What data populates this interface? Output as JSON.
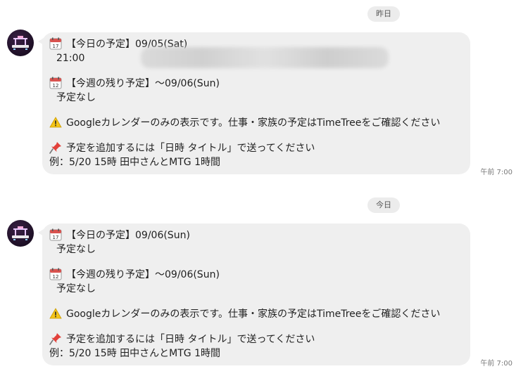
{
  "messages": [
    {
      "date_label": "昨日",
      "lines": {
        "today_header": "【今日の予定】09/05(Sat)",
        "today_item": "21:00",
        "week_header": "【今週の残り予定】〜09/06(Sun)",
        "week_item": "予定なし",
        "warning": "Googleカレンダーのみの表示です。仕事・家族の予定はTimeTreeをご確認ください",
        "add_hint": "予定を追加するには「日時 タイトル」で送ってください",
        "example": "例：5/20 15時 田中さんとMTG 1時間"
      },
      "time": "午前 7:00"
    },
    {
      "date_label": "今日",
      "lines": {
        "today_header": "【今日の予定】09/06(Sun)",
        "today_item": "予定なし",
        "week_header": "【今週の残り予定】〜09/06(Sun)",
        "week_item": "予定なし",
        "warning": "Googleカレンダーのみの表示です。仕事・家族の予定はTimeTreeをご確認ください",
        "add_hint": "予定を追加するには「日時 タイトル」で送ってください",
        "example": "例：5/20 15時 田中さんとMTG 1時間"
      },
      "time": "午前 7:00"
    }
  ],
  "icons": {
    "calendar_today": "calendar-17-icon",
    "calendar_week": "calendar-12-icon",
    "warning": "warning-icon",
    "pin": "pushpin-icon"
  },
  "colors": {
    "bubble": "#efefef",
    "date_chip": "#ececec",
    "calendar_red": "#d9534f",
    "warning_yellow": "#f5c518",
    "pin_red": "#e2413b"
  }
}
